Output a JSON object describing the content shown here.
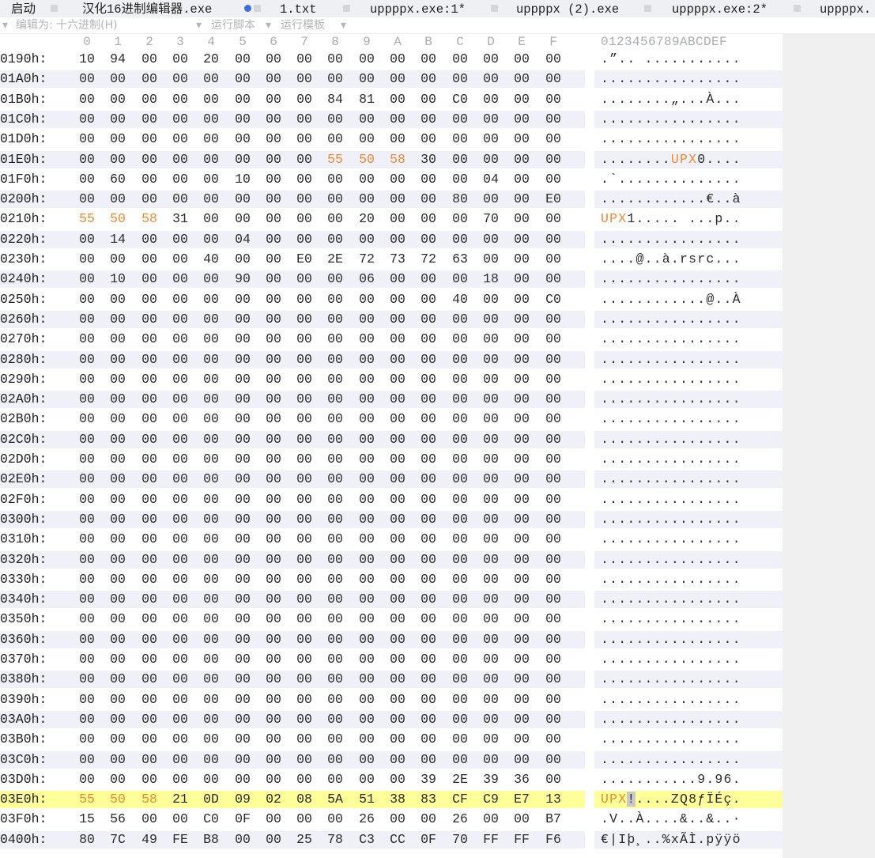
{
  "tabs": [
    {
      "label": "启动"
    },
    {
      "label": "汉化16进制编辑器.exe"
    },
    {
      "label": "1.txt"
    },
    {
      "label": "uppppx.exe:1*"
    },
    {
      "label": "uppppx (2).exe"
    },
    {
      "label": "uppppx.exe:2*"
    },
    {
      "label": "uppppx."
    }
  ],
  "menubar": {
    "edit_as": "编辑为: 十六进制(H)",
    "run_script": "运行脚本",
    "run_template": "运行模板"
  },
  "column_header": {
    "hex_columns": [
      "0",
      "1",
      "2",
      "3",
      "4",
      "5",
      "6",
      "7",
      "8",
      "9",
      "A",
      "B",
      "C",
      "D",
      "E",
      "F"
    ],
    "ascii": "0123456789ABCDEF"
  },
  "colors": {
    "accent_orange": "#f0892f",
    "highlight_row": "#ffff99",
    "alt_row": "#eff0f8"
  },
  "rows": [
    {
      "offset": "0190h:",
      "bytes": [
        "10",
        "94",
        "00",
        "00",
        "20",
        "00",
        "00",
        "00",
        "00",
        "00",
        "00",
        "00",
        "00",
        "00",
        "00",
        "00"
      ],
      "ascii": ".”.. ..........."
    },
    {
      "offset": "01A0h:",
      "bytes": [
        "00",
        "00",
        "00",
        "00",
        "00",
        "00",
        "00",
        "00",
        "00",
        "00",
        "00",
        "00",
        "00",
        "00",
        "00",
        "00"
      ],
      "ascii": "................"
    },
    {
      "offset": "01B0h:",
      "bytes": [
        "00",
        "00",
        "00",
        "00",
        "00",
        "00",
        "00",
        "00",
        "84",
        "81",
        "00",
        "00",
        "C0",
        "00",
        "00",
        "00"
      ],
      "ascii": "........„...À..."
    },
    {
      "offset": "01C0h:",
      "bytes": [
        "00",
        "00",
        "00",
        "00",
        "00",
        "00",
        "00",
        "00",
        "00",
        "00",
        "00",
        "00",
        "00",
        "00",
        "00",
        "00"
      ],
      "ascii": "................"
    },
    {
      "offset": "01D0h:",
      "bytes": [
        "00",
        "00",
        "00",
        "00",
        "00",
        "00",
        "00",
        "00",
        "00",
        "00",
        "00",
        "00",
        "00",
        "00",
        "00",
        "00"
      ],
      "ascii": "................"
    },
    {
      "offset": "01E0h:",
      "bytes": [
        "00",
        "00",
        "00",
        "00",
        "00",
        "00",
        "00",
        "00",
        "55",
        "50",
        "58",
        "30",
        "00",
        "00",
        "00",
        "00"
      ],
      "ascii": "........UPX0....",
      "orange": [
        8,
        9,
        10
      ],
      "ascii_orange": [
        8,
        9,
        10
      ]
    },
    {
      "offset": "01F0h:",
      "bytes": [
        "00",
        "60",
        "00",
        "00",
        "00",
        "10",
        "00",
        "00",
        "00",
        "00",
        "00",
        "00",
        "00",
        "04",
        "00",
        "00"
      ],
      "ascii": ".`.............."
    },
    {
      "offset": "0200h:",
      "bytes": [
        "00",
        "00",
        "00",
        "00",
        "00",
        "00",
        "00",
        "00",
        "00",
        "00",
        "00",
        "00",
        "80",
        "00",
        "00",
        "E0"
      ],
      "ascii": "............€..à"
    },
    {
      "offset": "0210h:",
      "bytes": [
        "55",
        "50",
        "58",
        "31",
        "00",
        "00",
        "00",
        "00",
        "00",
        "20",
        "00",
        "00",
        "00",
        "70",
        "00",
        "00"
      ],
      "ascii": "UPX1..... ...p..",
      "orange": [
        0,
        1,
        2
      ],
      "ascii_orange": [
        0,
        1,
        2
      ]
    },
    {
      "offset": "0220h:",
      "bytes": [
        "00",
        "14",
        "00",
        "00",
        "00",
        "04",
        "00",
        "00",
        "00",
        "00",
        "00",
        "00",
        "00",
        "00",
        "00",
        "00"
      ],
      "ascii": "................"
    },
    {
      "offset": "0230h:",
      "bytes": [
        "00",
        "00",
        "00",
        "00",
        "40",
        "00",
        "00",
        "E0",
        "2E",
        "72",
        "73",
        "72",
        "63",
        "00",
        "00",
        "00"
      ],
      "ascii": "....@..à.rsrc..."
    },
    {
      "offset": "0240h:",
      "bytes": [
        "00",
        "10",
        "00",
        "00",
        "00",
        "90",
        "00",
        "00",
        "00",
        "06",
        "00",
        "00",
        "00",
        "18",
        "00",
        "00"
      ],
      "ascii": "................"
    },
    {
      "offset": "0250h:",
      "bytes": [
        "00",
        "00",
        "00",
        "00",
        "00",
        "00",
        "00",
        "00",
        "00",
        "00",
        "00",
        "00",
        "40",
        "00",
        "00",
        "C0"
      ],
      "ascii": "............@..À"
    },
    {
      "offset": "0260h:",
      "bytes": [
        "00",
        "00",
        "00",
        "00",
        "00",
        "00",
        "00",
        "00",
        "00",
        "00",
        "00",
        "00",
        "00",
        "00",
        "00",
        "00"
      ],
      "ascii": "................"
    },
    {
      "offset": "0270h:",
      "bytes": [
        "00",
        "00",
        "00",
        "00",
        "00",
        "00",
        "00",
        "00",
        "00",
        "00",
        "00",
        "00",
        "00",
        "00",
        "00",
        "00"
      ],
      "ascii": "................"
    },
    {
      "offset": "0280h:",
      "bytes": [
        "00",
        "00",
        "00",
        "00",
        "00",
        "00",
        "00",
        "00",
        "00",
        "00",
        "00",
        "00",
        "00",
        "00",
        "00",
        "00"
      ],
      "ascii": "................"
    },
    {
      "offset": "0290h:",
      "bytes": [
        "00",
        "00",
        "00",
        "00",
        "00",
        "00",
        "00",
        "00",
        "00",
        "00",
        "00",
        "00",
        "00",
        "00",
        "00",
        "00"
      ],
      "ascii": "................"
    },
    {
      "offset": "02A0h:",
      "bytes": [
        "00",
        "00",
        "00",
        "00",
        "00",
        "00",
        "00",
        "00",
        "00",
        "00",
        "00",
        "00",
        "00",
        "00",
        "00",
        "00"
      ],
      "ascii": "................"
    },
    {
      "offset": "02B0h:",
      "bytes": [
        "00",
        "00",
        "00",
        "00",
        "00",
        "00",
        "00",
        "00",
        "00",
        "00",
        "00",
        "00",
        "00",
        "00",
        "00",
        "00"
      ],
      "ascii": "................"
    },
    {
      "offset": "02C0h:",
      "bytes": [
        "00",
        "00",
        "00",
        "00",
        "00",
        "00",
        "00",
        "00",
        "00",
        "00",
        "00",
        "00",
        "00",
        "00",
        "00",
        "00"
      ],
      "ascii": "................"
    },
    {
      "offset": "02D0h:",
      "bytes": [
        "00",
        "00",
        "00",
        "00",
        "00",
        "00",
        "00",
        "00",
        "00",
        "00",
        "00",
        "00",
        "00",
        "00",
        "00",
        "00"
      ],
      "ascii": "................"
    },
    {
      "offset": "02E0h:",
      "bytes": [
        "00",
        "00",
        "00",
        "00",
        "00",
        "00",
        "00",
        "00",
        "00",
        "00",
        "00",
        "00",
        "00",
        "00",
        "00",
        "00"
      ],
      "ascii": "................"
    },
    {
      "offset": "02F0h:",
      "bytes": [
        "00",
        "00",
        "00",
        "00",
        "00",
        "00",
        "00",
        "00",
        "00",
        "00",
        "00",
        "00",
        "00",
        "00",
        "00",
        "00"
      ],
      "ascii": "................"
    },
    {
      "offset": "0300h:",
      "bytes": [
        "00",
        "00",
        "00",
        "00",
        "00",
        "00",
        "00",
        "00",
        "00",
        "00",
        "00",
        "00",
        "00",
        "00",
        "00",
        "00"
      ],
      "ascii": "................"
    },
    {
      "offset": "0310h:",
      "bytes": [
        "00",
        "00",
        "00",
        "00",
        "00",
        "00",
        "00",
        "00",
        "00",
        "00",
        "00",
        "00",
        "00",
        "00",
        "00",
        "00"
      ],
      "ascii": "................"
    },
    {
      "offset": "0320h:",
      "bytes": [
        "00",
        "00",
        "00",
        "00",
        "00",
        "00",
        "00",
        "00",
        "00",
        "00",
        "00",
        "00",
        "00",
        "00",
        "00",
        "00"
      ],
      "ascii": "................"
    },
    {
      "offset": "0330h:",
      "bytes": [
        "00",
        "00",
        "00",
        "00",
        "00",
        "00",
        "00",
        "00",
        "00",
        "00",
        "00",
        "00",
        "00",
        "00",
        "00",
        "00"
      ],
      "ascii": "................"
    },
    {
      "offset": "0340h:",
      "bytes": [
        "00",
        "00",
        "00",
        "00",
        "00",
        "00",
        "00",
        "00",
        "00",
        "00",
        "00",
        "00",
        "00",
        "00",
        "00",
        "00"
      ],
      "ascii": "................"
    },
    {
      "offset": "0350h:",
      "bytes": [
        "00",
        "00",
        "00",
        "00",
        "00",
        "00",
        "00",
        "00",
        "00",
        "00",
        "00",
        "00",
        "00",
        "00",
        "00",
        "00"
      ],
      "ascii": "................"
    },
    {
      "offset": "0360h:",
      "bytes": [
        "00",
        "00",
        "00",
        "00",
        "00",
        "00",
        "00",
        "00",
        "00",
        "00",
        "00",
        "00",
        "00",
        "00",
        "00",
        "00"
      ],
      "ascii": "................"
    },
    {
      "offset": "0370h:",
      "bytes": [
        "00",
        "00",
        "00",
        "00",
        "00",
        "00",
        "00",
        "00",
        "00",
        "00",
        "00",
        "00",
        "00",
        "00",
        "00",
        "00"
      ],
      "ascii": "................"
    },
    {
      "offset": "0380h:",
      "bytes": [
        "00",
        "00",
        "00",
        "00",
        "00",
        "00",
        "00",
        "00",
        "00",
        "00",
        "00",
        "00",
        "00",
        "00",
        "00",
        "00"
      ],
      "ascii": "................"
    },
    {
      "offset": "0390h:",
      "bytes": [
        "00",
        "00",
        "00",
        "00",
        "00",
        "00",
        "00",
        "00",
        "00",
        "00",
        "00",
        "00",
        "00",
        "00",
        "00",
        "00"
      ],
      "ascii": "................"
    },
    {
      "offset": "03A0h:",
      "bytes": [
        "00",
        "00",
        "00",
        "00",
        "00",
        "00",
        "00",
        "00",
        "00",
        "00",
        "00",
        "00",
        "00",
        "00",
        "00",
        "00"
      ],
      "ascii": "................"
    },
    {
      "offset": "03B0h:",
      "bytes": [
        "00",
        "00",
        "00",
        "00",
        "00",
        "00",
        "00",
        "00",
        "00",
        "00",
        "00",
        "00",
        "00",
        "00",
        "00",
        "00"
      ],
      "ascii": "................"
    },
    {
      "offset": "03C0h:",
      "bytes": [
        "00",
        "00",
        "00",
        "00",
        "00",
        "00",
        "00",
        "00",
        "00",
        "00",
        "00",
        "00",
        "00",
        "00",
        "00",
        "00"
      ],
      "ascii": "................"
    },
    {
      "offset": "03D0h:",
      "bytes": [
        "00",
        "00",
        "00",
        "00",
        "00",
        "00",
        "00",
        "00",
        "00",
        "00",
        "00",
        "39",
        "2E",
        "39",
        "36",
        "00"
      ],
      "ascii": "...........9.96."
    },
    {
      "offset": "03E0h:",
      "bytes": [
        "55",
        "50",
        "58",
        "21",
        "0D",
        "09",
        "02",
        "08",
        "5A",
        "51",
        "38",
        "83",
        "CF",
        "C9",
        "E7",
        "13"
      ],
      "ascii": "UPX!....ZQ8ƒÏÉç.",
      "orange": [
        0,
        1,
        2
      ],
      "ascii_orange": [
        0,
        1,
        2
      ],
      "ascii_selected": [
        3
      ],
      "highlight": true
    },
    {
      "offset": "03F0h:",
      "bytes": [
        "15",
        "56",
        "00",
        "00",
        "C0",
        "0F",
        "00",
        "00",
        "00",
        "26",
        "00",
        "00",
        "26",
        "00",
        "00",
        "B7"
      ],
      "ascii": ".V..À....&..&..·"
    },
    {
      "offset": "0400h:",
      "bytes": [
        "80",
        "7C",
        "49",
        "FE",
        "B8",
        "00",
        "00",
        "25",
        "78",
        "C3",
        "CC",
        "0F",
        "70",
        "FF",
        "FF",
        "F6"
      ],
      "ascii": "€|Iþ¸..%xÃÌ.pÿÿö"
    }
  ]
}
